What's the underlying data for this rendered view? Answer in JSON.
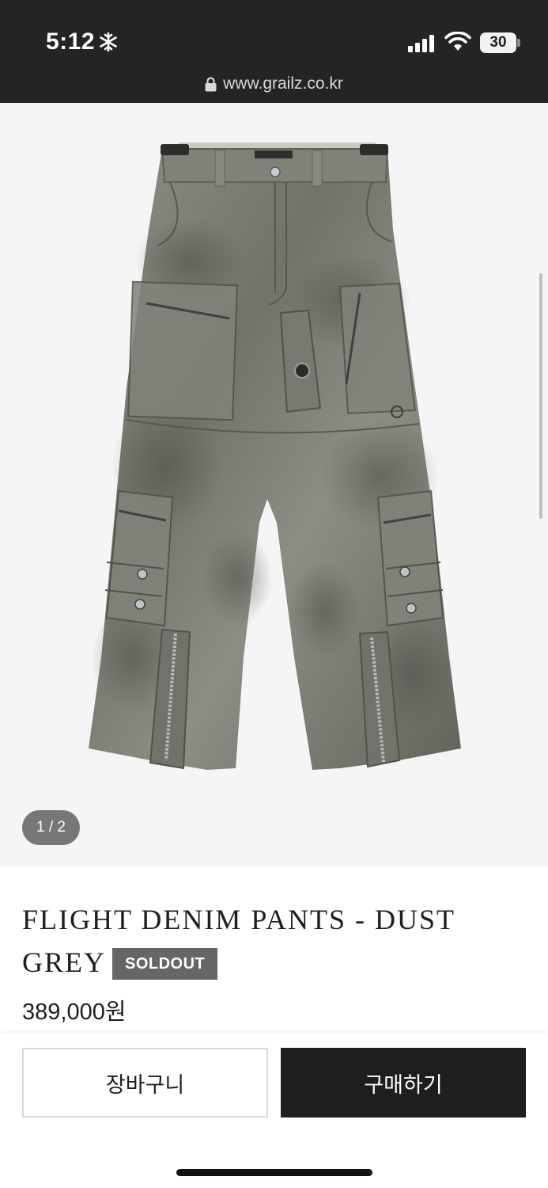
{
  "status_bar": {
    "time": "5:12",
    "battery": "30"
  },
  "browser": {
    "url": "www.grailz.co.kr"
  },
  "gallery": {
    "counter": "1 / 2"
  },
  "product": {
    "name": "FLIGHT DENIM PANTS - DUST GREY",
    "badge": "SOLDOUT",
    "price": "389,000원"
  },
  "actions": {
    "cart_label": "장바구니",
    "buy_label": "구매하기"
  },
  "colors": {
    "chrome": "#242424",
    "gallery_bg": "#f5f5f5",
    "badge_bg": "#666666",
    "buy_button": "#1e1e1e"
  }
}
